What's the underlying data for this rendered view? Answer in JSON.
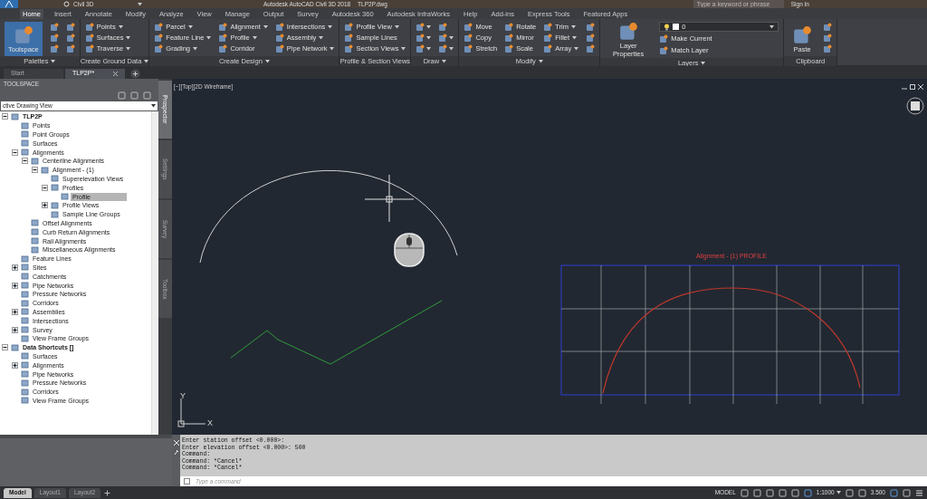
{
  "title_bar": {
    "workspace": "Civil 3D",
    "title": "Autodesk AutoCAD Civil 3D 2018",
    "file": "TLP2P.dwg",
    "search": {
      "placeholder": "Type a keyword or phrase"
    },
    "sign_in": "Sign In"
  },
  "ribbon_tabs": [
    {
      "label": "Home",
      "selected": true
    },
    {
      "label": "Insert",
      "selected": false
    },
    {
      "label": "Annotate",
      "selected": false
    },
    {
      "label": "Modify",
      "selected": false
    },
    {
      "label": "Analyze",
      "selected": false
    },
    {
      "label": "View",
      "selected": false
    },
    {
      "label": "Manage",
      "selected": false
    },
    {
      "label": "Output",
      "selected": false
    },
    {
      "label": "Survey",
      "selected": false
    },
    {
      "label": "Autodesk 360",
      "selected": false
    },
    {
      "label": "Autodesk InfraWorks",
      "selected": false
    },
    {
      "label": "Help",
      "selected": false
    },
    {
      "label": "Add-ins",
      "selected": false
    },
    {
      "label": "Express Tools",
      "selected": false
    },
    {
      "label": "Featured Apps",
      "selected": false
    }
  ],
  "ribbon_panels": [
    {
      "title": "Palettes",
      "title_dropdown": true,
      "columns": [
        [
          {
            "kind": "large",
            "label": "Toolspace",
            "selected": true
          }
        ],
        [
          {
            "kind": "icon",
            "dropdown": false
          },
          {
            "kind": "icon",
            "dropdown": false
          },
          {
            "kind": "icon",
            "dropdown": false
          }
        ],
        [
          {
            "kind": "icon",
            "dropdown": false
          },
          {
            "kind": "icon",
            "dropdown": false
          },
          {
            "kind": "icon",
            "dropdown": false
          }
        ]
      ]
    },
    {
      "title": "Create Ground Data",
      "title_dropdown": true,
      "columns": [
        [
          {
            "kind": "tool",
            "label": "Points",
            "dropdown": true
          },
          {
            "kind": "tool",
            "label": "Surfaces",
            "dropdown": true
          },
          {
            "kind": "tool",
            "label": "Traverse",
            "dropdown": true
          }
        ]
      ]
    },
    {
      "title": "Create Design",
      "title_dropdown": true,
      "columns": [
        [
          {
            "kind": "tool",
            "label": "Parcel",
            "dropdown": true
          },
          {
            "kind": "tool",
            "label": "Feature Line",
            "dropdown": true
          },
          {
            "kind": "tool",
            "label": "Grading",
            "dropdown": true
          }
        ],
        [
          {
            "kind": "tool",
            "label": "Alignment",
            "dropdown": true
          },
          {
            "kind": "tool",
            "label": "Profile",
            "dropdown": true
          },
          {
            "kind": "tool",
            "label": "Corridor",
            "dropdown": false
          }
        ],
        [
          {
            "kind": "tool",
            "label": "Intersections",
            "dropdown": true
          },
          {
            "kind": "tool",
            "label": "Assembly",
            "dropdown": true
          },
          {
            "kind": "tool",
            "label": "Pipe Network",
            "dropdown": true
          }
        ]
      ]
    },
    {
      "title": "Profile & Section Views",
      "title_dropdown": false,
      "columns": [
        [
          {
            "kind": "tool",
            "label": "Profile View",
            "dropdown": true
          },
          {
            "kind": "tool",
            "label": "Sample Lines",
            "dropdown": false
          },
          {
            "kind": "tool",
            "label": "Section Views",
            "dropdown": true
          }
        ]
      ]
    },
    {
      "title": "Draw",
      "title_dropdown": true,
      "columns": [
        [
          {
            "kind": "icon",
            "dropdown": true
          },
          {
            "kind": "icon",
            "dropdown": true
          },
          {
            "kind": "icon",
            "dropdown": true
          }
        ],
        [
          {
            "kind": "icon",
            "dropdown": false
          },
          {
            "kind": "icon",
            "dropdown": true
          },
          {
            "kind": "icon",
            "dropdown": true
          }
        ]
      ]
    },
    {
      "title": "Modify",
      "title_dropdown": true,
      "columns": [
        [
          {
            "kind": "tool",
            "label": "Move",
            "dropdown": false
          },
          {
            "kind": "tool",
            "label": "Copy",
            "dropdown": false
          },
          {
            "kind": "tool",
            "label": "Stretch",
            "dropdown": false
          }
        ],
        [
          {
            "kind": "tool",
            "label": "Rotate",
            "dropdown": false
          },
          {
            "kind": "tool",
            "label": "Mirror",
            "dropdown": false
          },
          {
            "kind": "tool",
            "label": "Scale",
            "dropdown": false
          }
        ],
        [
          {
            "kind": "tool",
            "label": "Trim",
            "dropdown": true
          },
          {
            "kind": "tool",
            "label": "Fillet",
            "dropdown": true
          },
          {
            "kind": "tool",
            "label": "Array",
            "dropdown": true
          }
        ],
        [
          {
            "kind": "icon",
            "dropdown": false
          },
          {
            "kind": "icon",
            "dropdown": false
          },
          {
            "kind": "icon",
            "dropdown": false
          }
        ]
      ]
    },
    {
      "title": "Layers",
      "title_dropdown": true,
      "columns": [
        [
          {
            "kind": "large",
            "label": "Layer Properties",
            "selected": false
          }
        ],
        [
          {
            "kind": "combo",
            "label": "0"
          },
          {
            "kind": "tool",
            "label": "Make Current",
            "dropdown": false
          },
          {
            "kind": "tool",
            "label": "Match Layer",
            "dropdown": false
          }
        ]
      ]
    },
    {
      "title": "Clipboard",
      "title_dropdown": false,
      "columns": [
        [
          {
            "kind": "large",
            "label": "Paste",
            "selected": false
          }
        ],
        [
          {
            "kind": "icon",
            "dropdown": false
          },
          {
            "kind": "icon",
            "dropdown": false
          },
          {
            "kind": "icon",
            "dropdown": false
          }
        ]
      ]
    }
  ],
  "file_tabs": [
    {
      "label": "Start",
      "selected": false
    },
    {
      "label": "TLP2P*",
      "selected": true
    }
  ],
  "toolspace": {
    "title": "TOOLSPACE",
    "view_select": "ctive Drawing View",
    "tree": [
      {
        "label": "TLP2P",
        "expanded": true,
        "selected": false,
        "children": [
          {
            "label": "Points",
            "selected": false
          },
          {
            "label": "Point Groups",
            "selected": false
          },
          {
            "label": "Surfaces",
            "selected": false
          },
          {
            "label": "Alignments",
            "expanded": true,
            "selected": false,
            "children": [
              {
                "label": "Centerline Alignments",
                "expanded": true,
                "selected": false,
                "children": [
                  {
                    "label": "Alignment - (1)",
                    "expanded": true,
                    "selected": false,
                    "children": [
                      {
                        "label": "Superelevation Views",
                        "selected": false
                      },
                      {
                        "label": "Profiles",
                        "expanded": true,
                        "selected": false,
                        "children": [
                          {
                            "label": "Profile",
                            "selected": true
                          }
                        ]
                      },
                      {
                        "label": "Profile Views",
                        "expanded": false,
                        "selected": false
                      },
                      {
                        "label": "Sample Line Groups",
                        "selected": false
                      }
                    ]
                  }
                ]
              },
              {
                "label": "Offset Alignments",
                "selected": false
              },
              {
                "label": "Curb Return Alignments",
                "selected": false
              },
              {
                "label": "Rail Alignments",
                "selected": false
              },
              {
                "label": "Miscellaneous Alignments",
                "selected": false
              }
            ]
          },
          {
            "label": "Feature Lines",
            "selected": false
          },
          {
            "label": "Sites",
            "expanded": false,
            "selected": false
          },
          {
            "label": "Catchments",
            "selected": false
          },
          {
            "label": "Pipe Networks",
            "expanded": false,
            "selected": false
          },
          {
            "label": "Pressure Networks",
            "selected": false
          },
          {
            "label": "Corridors",
            "selected": false
          },
          {
            "label": "Assemblies",
            "expanded": false,
            "selected": false
          },
          {
            "label": "Intersections",
            "selected": false
          },
          {
            "label": "Survey",
            "expanded": false,
            "selected": false
          },
          {
            "label": "View Frame Groups",
            "selected": false
          }
        ]
      },
      {
        "label": "Data Shortcuts []",
        "expanded": true,
        "selected": false,
        "children": [
          {
            "label": "Surfaces",
            "selected": false
          },
          {
            "label": "Alignments",
            "expanded": false,
            "selected": false
          },
          {
            "label": "Pipe Networks",
            "selected": false
          },
          {
            "label": "Pressure Networks",
            "selected": false
          },
          {
            "label": "Corridors",
            "selected": false
          },
          {
            "label": "View Frame Groups",
            "selected": false
          }
        ]
      }
    ]
  },
  "side_tabs": [
    {
      "label": "Prospector",
      "selected": true
    },
    {
      "label": "Settings",
      "selected": false
    },
    {
      "label": "Survey",
      "selected": false
    },
    {
      "label": "Toolbox",
      "selected": false
    }
  ],
  "viewport": {
    "label": "[−][Top][2D Wireframe]",
    "ucs_y": "Y",
    "ucs_x": "X",
    "profile_title": "Alignment - (1) PROFILE"
  },
  "command": {
    "history": [
      "Enter station offset <0.000>:",
      "Enter elevation offset <0.000>: 500",
      "Command:",
      "Command: *Cancel*",
      "Command: *Cancel*"
    ],
    "placeholder": "Type a command"
  },
  "layout_tabs": [
    {
      "label": "Model",
      "selected": true
    },
    {
      "label": "Layout1",
      "selected": false
    },
    {
      "label": "Layout2",
      "selected": false
    }
  ],
  "status": {
    "space": "MODEL",
    "scale": "1:1000",
    "value": "3.500"
  }
}
